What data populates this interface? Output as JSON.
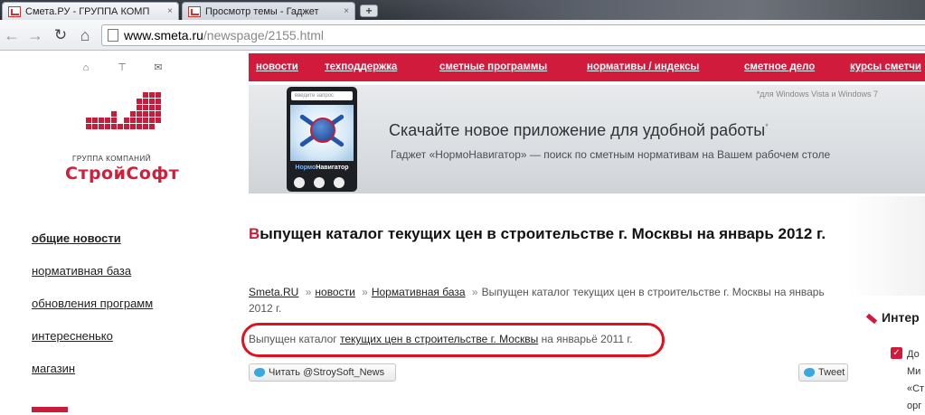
{
  "browser": {
    "tabs": [
      {
        "title": "Смета.РУ - ГРУППА КОМП",
        "close": "×"
      },
      {
        "title": "Просмотр темы - Гаджет",
        "close": "×"
      }
    ],
    "new_tab": "+",
    "url_host": "www.smeta.ru",
    "url_path": "/newspage/2155.html",
    "nav_icons": {
      "back": "back-arrow-icon",
      "forward": "forward-arrow-icon",
      "reload": "reload-icon",
      "home": "home-icon"
    }
  },
  "header_icons": [
    "home-icon",
    "sitemap-icon",
    "mail-icon"
  ],
  "logo": {
    "subtitle": "ГРУППА КОМПАНИЙ",
    "name": "СтройСофт",
    "color": "#c91b3a"
  },
  "left_nav": [
    {
      "label": "общие новости",
      "active": true
    },
    {
      "label": "нормативная база",
      "active": false
    },
    {
      "label": "обновления программ",
      "active": false
    },
    {
      "label": "интересненько",
      "active": false
    },
    {
      "label": "магазин",
      "active": false
    }
  ],
  "top_menu": [
    "новости",
    "техподдержка",
    "сметные программы",
    "нормативы / индексы",
    "сметное дело",
    "курсы сметчи"
  ],
  "banner": {
    "note": "*для Windows Vista и Windows 7",
    "headline": "Скачайте новое приложение для удобной работы",
    "asterisk": "*",
    "subline": "Гаджет «НормоНавигатор» — поиск по сметным нормативам на Вашем рабочем столе",
    "gadget_search": "введите запрос",
    "gadget_label_a": "Нормо",
    "gadget_label_b": "Навигатор"
  },
  "article": {
    "title_first": "В",
    "title_rest": "ыпущен каталог текущих цен в строительстве г. Москвы на январь 2012 г.",
    "breadcrumbs": {
      "home": "Smeta.RU",
      "sep": "»",
      "news": "новости",
      "section": "Нормативная база",
      "current": "Выпущен каталог текущих цен в строительстве г. Москвы на январь 2012 г."
    },
    "lead_before": "Выпущен каталог",
    "lead_link": "текущих цен в строительстве г. Москвы",
    "lead_after": "на январьё 2011 г."
  },
  "social": {
    "read_label": "Читать @StroySoft_News",
    "tweet_label": "Tweet"
  },
  "right_col": {
    "title": "Интер",
    "lines": [
      "До",
      "Ми",
      "«Ст",
      "орг"
    ]
  }
}
